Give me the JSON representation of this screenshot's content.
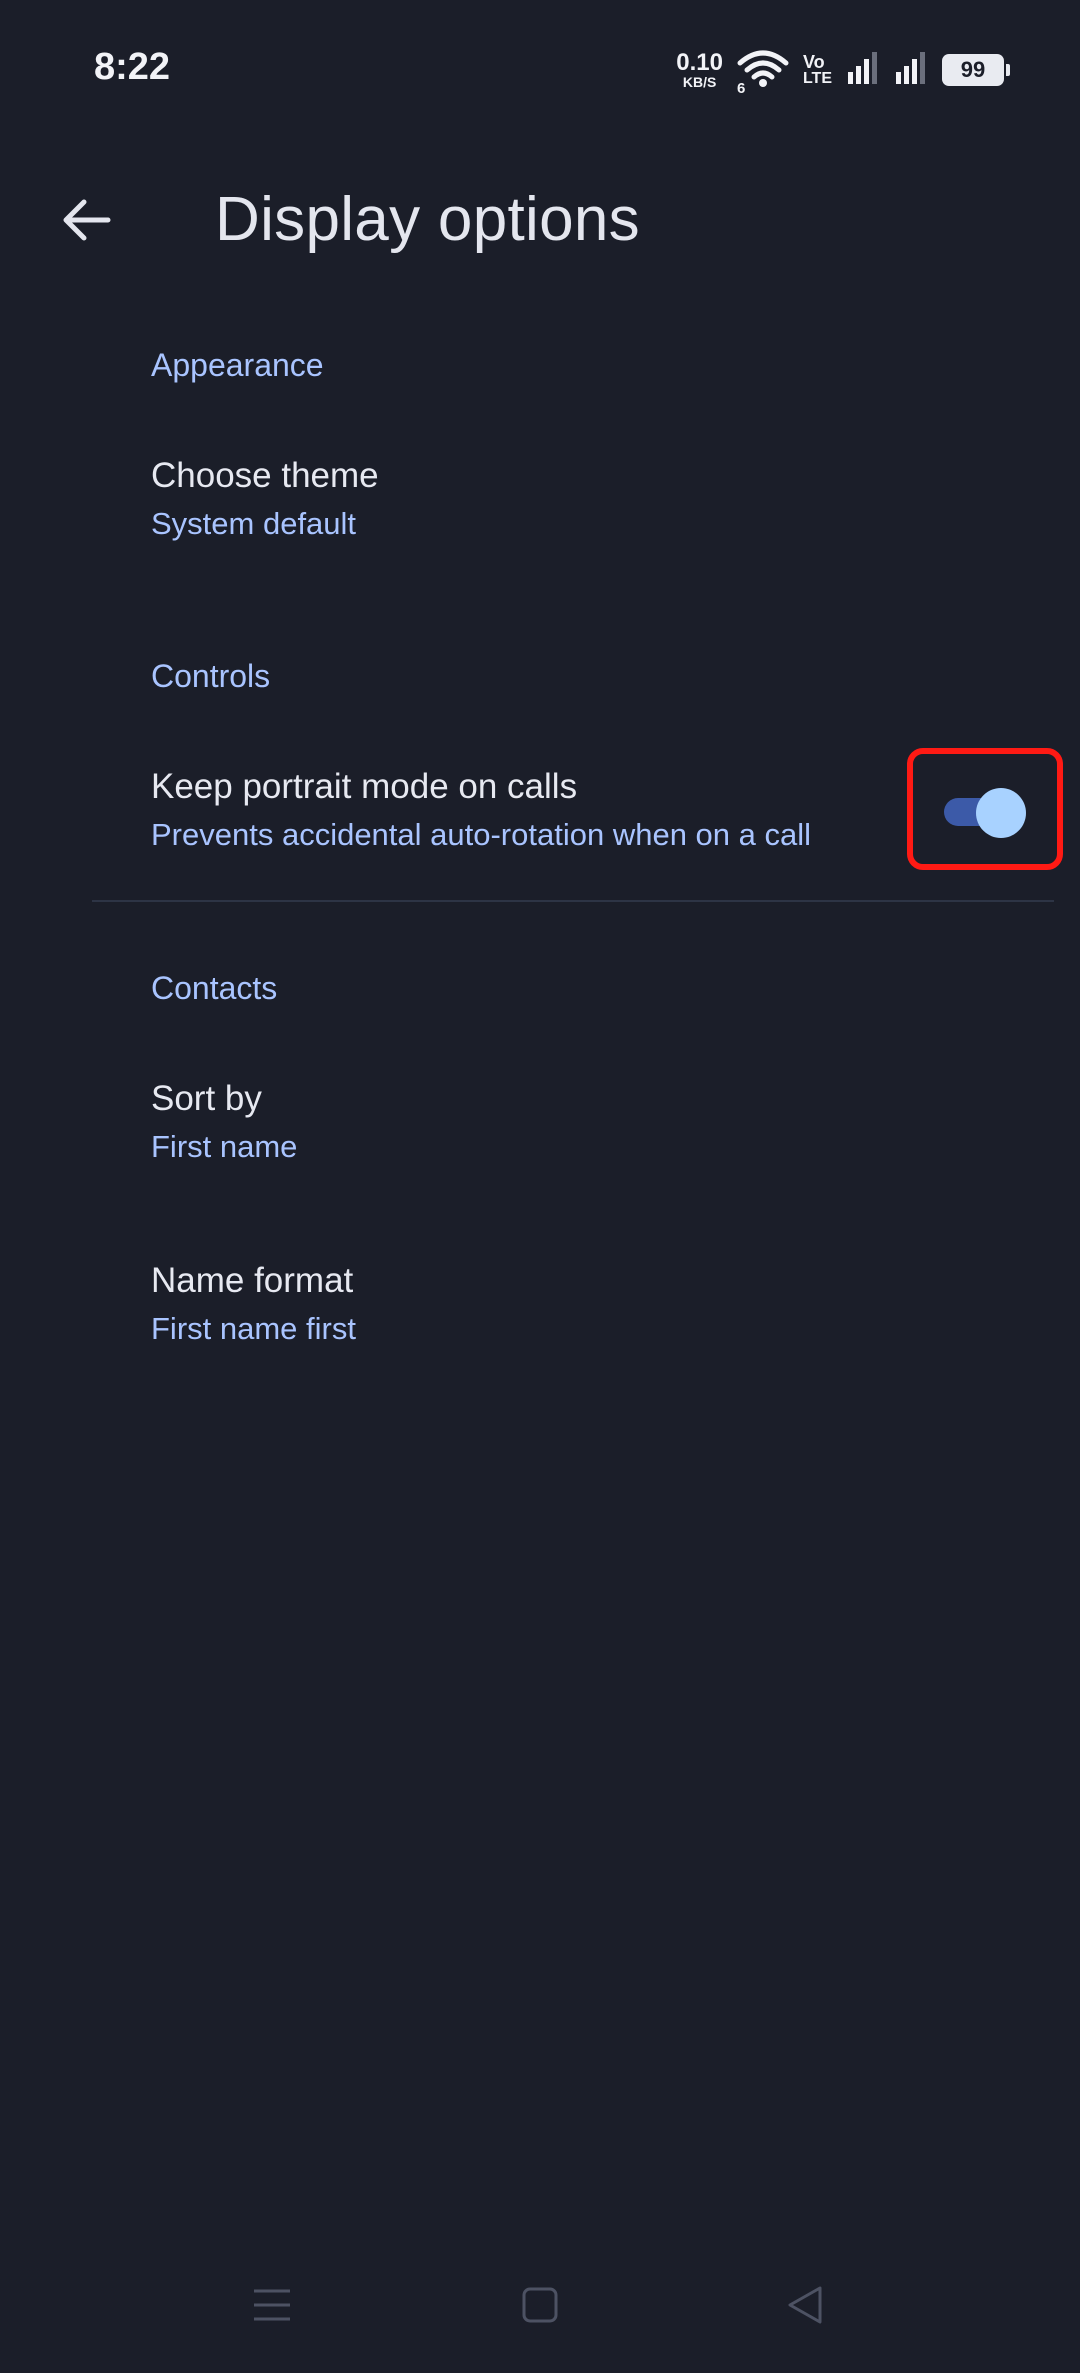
{
  "status_bar": {
    "time": "8:22",
    "net_speed": "0.10",
    "net_speed_unit": "KB/S",
    "wifi_label": "6",
    "volte_top": "Vo",
    "volte_bottom": "LTE",
    "battery": "99"
  },
  "app_bar": {
    "title": "Display options",
    "back_icon": "arrow-back-icon"
  },
  "sections": {
    "appearance": {
      "header": "Appearance",
      "items": [
        {
          "title": "Choose theme",
          "summary": "System default"
        }
      ]
    },
    "controls": {
      "header": "Controls",
      "items": [
        {
          "title": "Keep portrait mode on calls",
          "summary": "Prevents accidental auto-rotation when on a call",
          "toggle_on": true
        }
      ]
    },
    "contacts": {
      "header": "Contacts",
      "items": [
        {
          "title": "Sort by",
          "summary": "First name"
        },
        {
          "title": "Name format",
          "summary": "First name first"
        }
      ]
    }
  },
  "nav_bar": {
    "icons": [
      "menu-icon",
      "home-icon",
      "back-triangle-icon"
    ]
  },
  "colors": {
    "background": "#1b1e29",
    "accent": "#a9c4ff",
    "toggle_track": "#3c5aa8",
    "toggle_thumb": "#a8d2ff",
    "highlight": "#ff1a14"
  }
}
